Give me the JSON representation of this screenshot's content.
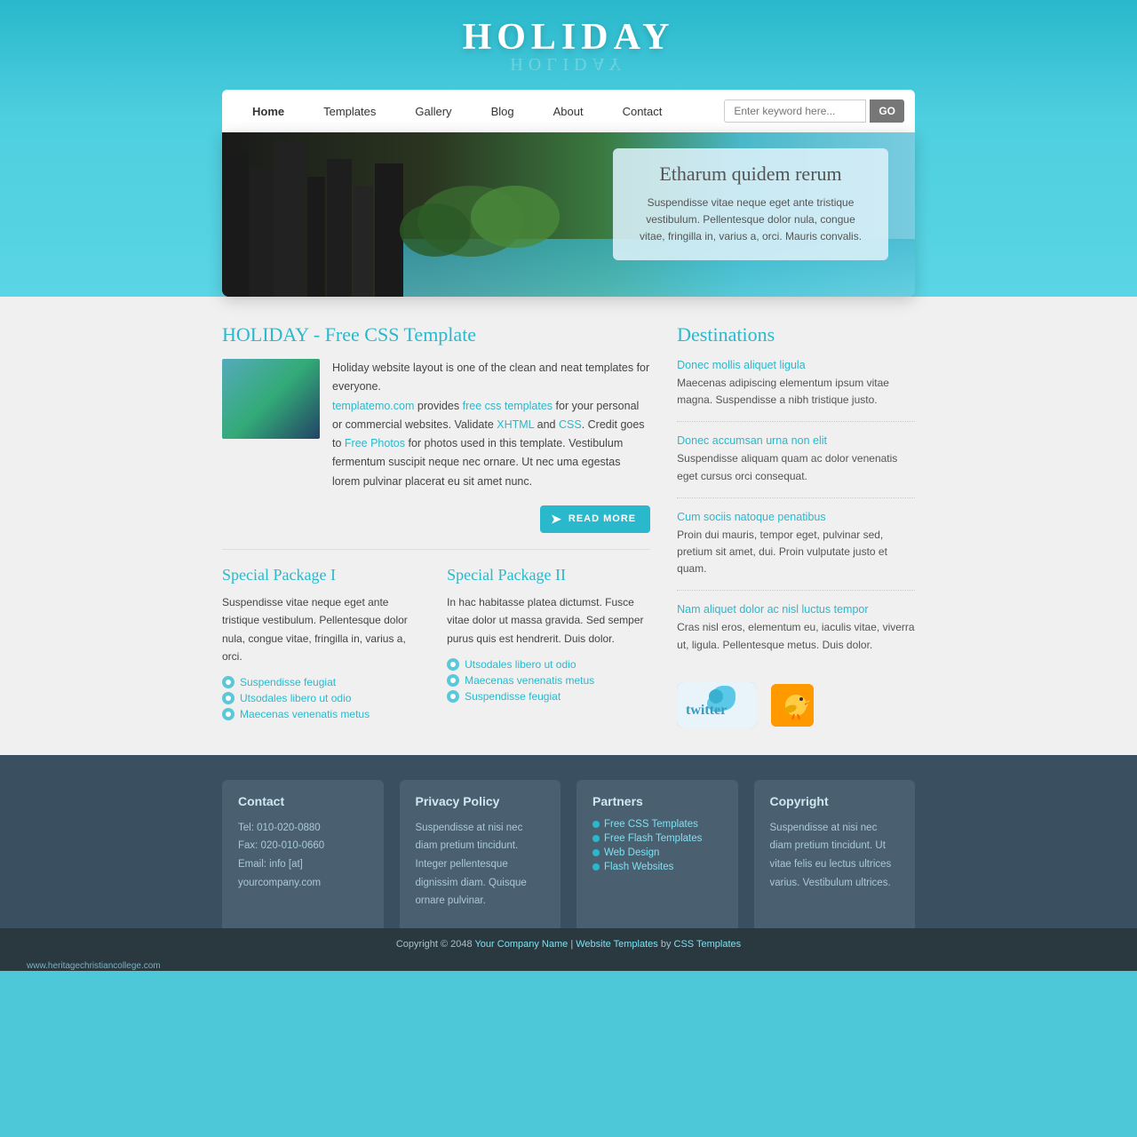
{
  "site": {
    "title": "HOLIDAY",
    "title_reflection": "HOLIDAY"
  },
  "nav": {
    "items": [
      {
        "label": "Home",
        "active": true
      },
      {
        "label": "Templates",
        "active": false
      },
      {
        "label": "Gallery",
        "active": false
      },
      {
        "label": "Blog",
        "active": false
      },
      {
        "label": "About",
        "active": false
      },
      {
        "label": "Contact",
        "active": false
      }
    ],
    "search_placeholder": "Enter keyword here...",
    "search_btn": "GO"
  },
  "hero": {
    "heading": "Etharum quidem rerum",
    "body": "Suspendisse vitae neque eget ante tristique vestibulum. Pellentesque dolor nula, congue vitae, fringilla in, varius a, orci. Mauris convalis."
  },
  "main": {
    "heading": "HOLIDAY - Free CSS Template",
    "about_p1": "Holiday website layout is one of the clean and neat templates for everyone.",
    "about_link1": "templatemo.com",
    "about_p2": " provides ",
    "about_link2": "free css templates",
    "about_p3": " for your personal or commercial websites. Validate ",
    "about_link3": "XHTML",
    "about_p4": " and ",
    "about_link4": "CSS",
    "about_p5": ". Credit goes to ",
    "about_link5": "Free Photos",
    "about_p6": " for photos used in this template. Vestibulum fermentum suscipit neque nec ornare. Ut nec uma egestas lorem pulvinar placerat eu sit amet nunc.",
    "read_more": "READ MORE",
    "packages": [
      {
        "heading": "Special Package I",
        "text": "Suspendisse vitae neque eget ante tristique vestibulum. Pellentesque dolor nula, congue vitae, fringilla in, varius a, orci.",
        "links": [
          "Suspendisse feugiat",
          "Utsodales libero ut odio",
          "Maecenas venenatis metus"
        ]
      },
      {
        "heading": "Special Package II",
        "text": "In hac habitasse platea dictumst. Fusce vitae dolor ut massa gravida. Sed semper purus quis est hendrerit. Duis dolor.",
        "links": [
          "Utsodales libero ut odio",
          "Maecenas venenatis metus",
          "Suspendisse feugiat"
        ]
      }
    ]
  },
  "destinations": {
    "heading": "Destinations",
    "items": [
      {
        "link": "Donec mollis aliquet ligula",
        "text": "Maecenas adipiscing elementum ipsum vitae magna. Suspendisse a nibh tristique justo."
      },
      {
        "link": "Donec accumsan urna non elit",
        "text": "Suspendisse aliquam quam ac dolor venenatis eget cursus orci consequat."
      },
      {
        "link": "Cum sociis natoque penatibus",
        "text": "Proin dui mauris, tempor eget, pulvinar sed, pretium sit amet, dui. Proin vulputate justo et quam."
      },
      {
        "link": "Nam aliquet dolor ac nisl luctus tempor",
        "text": "Cras nisl eros, elementum eu, iaculis vitae, viverra ut, ligula. Pellentesque metus. Duis dolor."
      }
    ]
  },
  "footer": {
    "contact": {
      "heading": "Contact",
      "tel": "Tel: 010-020-0880",
      "fax": "Fax: 020-010-0660",
      "email": "Email: info [at] yourcompany.com"
    },
    "privacy": {
      "heading": "Privacy Policy",
      "text": "Suspendisse at nisi nec diam pretium tincidunt. Integer pellentesque dignissim diam. Quisque ornare pulvinar."
    },
    "partners": {
      "heading": "Partners",
      "links": [
        "Free CSS Templates",
        "Free Flash Templates",
        "Web Design",
        "Flash Websites"
      ]
    },
    "copyright_col": {
      "heading": "Copyright",
      "text": "Suspendisse at nisi nec diam pretium tincidunt. Ut vitae felis eu lectus ultrices varius. Vestibulum ultrices."
    },
    "bar": {
      "text": "Copyright © 2048 ",
      "link1": "Your Company Name",
      "sep1": " | ",
      "link2": "Website Templates",
      "by": " by ",
      "link3": "CSS Templates"
    },
    "url": "www.heritagechristiancollege.com"
  }
}
